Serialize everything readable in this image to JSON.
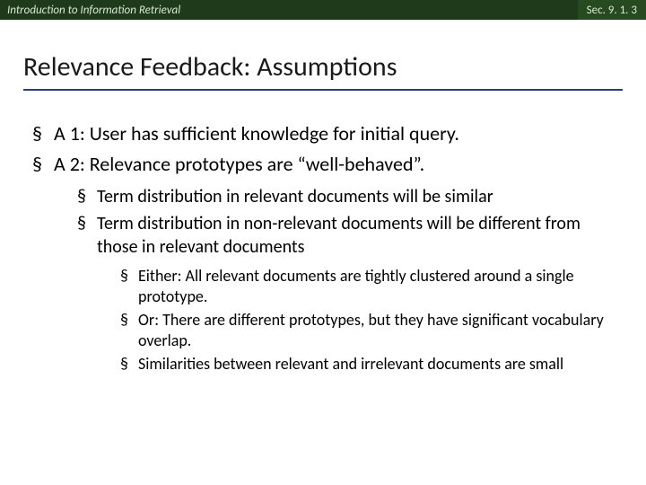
{
  "header": {
    "left": "Introduction to Information Retrieval",
    "right": "Sec. 9. 1. 3"
  },
  "title": "Relevance Feedback: Assumptions",
  "bullets": {
    "a1": "A 1: User has sufficient knowledge for initial query.",
    "a2": "A 2: Relevance prototypes are “well-behaved”.",
    "sub1": "Term distribution in relevant documents will be similar",
    "sub2": "Term distribution in non-relevant documents will be different from those in relevant documents",
    "subsub1": "Either: All relevant documents are tightly clustered around a single prototype.",
    "subsub2": "Or: There are different prototypes, but they have significant vocabulary overlap.",
    "subsub3": "Similarities between relevant and irrelevant documents are small"
  }
}
